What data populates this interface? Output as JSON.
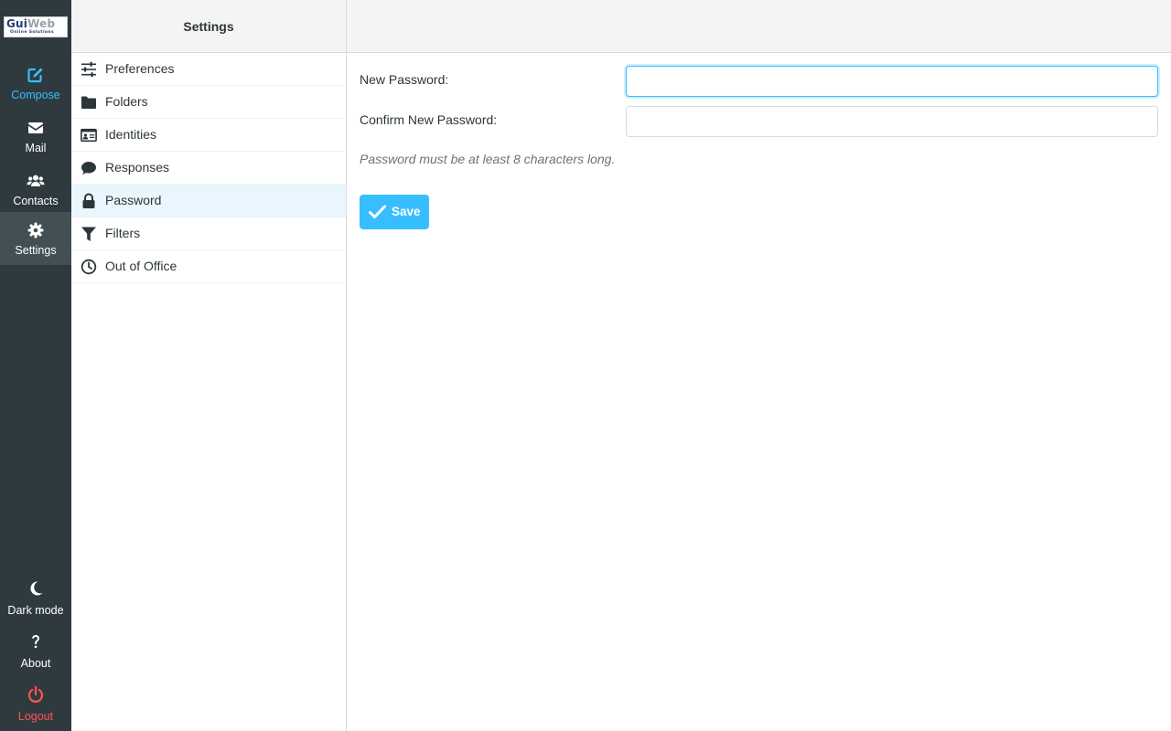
{
  "logo": {
    "text_part1": "Gui",
    "text_part2": "Web",
    "tagline": "Online Solutions"
  },
  "nav": {
    "compose": "Compose",
    "mail": "Mail",
    "contacts": "Contacts",
    "settings": "Settings",
    "dark_mode": "Dark mode",
    "about": "About",
    "logout": "Logout"
  },
  "settings_panel": {
    "title": "Settings",
    "items": [
      {
        "label": "Preferences",
        "icon": "sliders-icon"
      },
      {
        "label": "Folders",
        "icon": "folder-icon"
      },
      {
        "label": "Identities",
        "icon": "id-card-icon"
      },
      {
        "label": "Responses",
        "icon": "comment-icon"
      },
      {
        "label": "Password",
        "icon": "lock-icon",
        "selected": true
      },
      {
        "label": "Filters",
        "icon": "filter-icon"
      },
      {
        "label": "Out of Office",
        "icon": "clock-icon"
      }
    ]
  },
  "password_form": {
    "new_password_label": "New Password:",
    "new_password_value": "",
    "confirm_password_label": "Confirm New Password:",
    "confirm_password_value": "",
    "hint": "Password must be at least 8 characters long.",
    "save_label": "Save"
  },
  "colors": {
    "rail_bg": "#2f3a3f",
    "rail_selected": "#424f55",
    "accent": "#37beff",
    "logout": "#ff5552",
    "selected_item_bg": "#e9f6fd"
  }
}
